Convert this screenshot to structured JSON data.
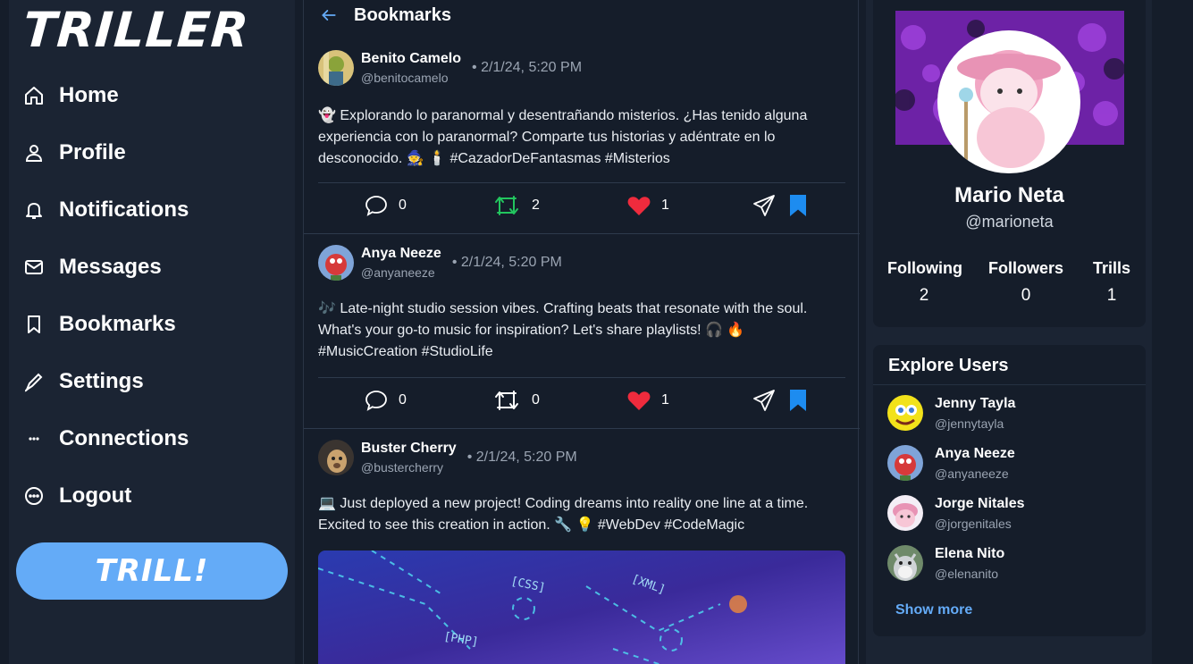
{
  "app": {
    "logo": "TRILLER",
    "trill_button": "TRILL!"
  },
  "sidebar": {
    "items": [
      {
        "label": "Home",
        "icon": "home-icon"
      },
      {
        "label": "Profile",
        "icon": "user-icon"
      },
      {
        "label": "Notifications",
        "icon": "bell-icon"
      },
      {
        "label": "Messages",
        "icon": "mail-icon"
      },
      {
        "label": "Bookmarks",
        "icon": "bookmark-icon"
      },
      {
        "label": "Settings",
        "icon": "pen-icon"
      },
      {
        "label": "Connections",
        "icon": "dots-icon"
      },
      {
        "label": "Logout",
        "icon": "dots-circle-icon"
      }
    ]
  },
  "feed": {
    "title": "Bookmarks",
    "posts": [
      {
        "name": "Benito Camelo",
        "handle": "@benitocamelo",
        "time": "• 2/1/24, 5:20 PM",
        "text": "👻 Explorando lo paranormal y desentrañando misterios. ¿Has tenido alguna experiencia con lo paranormal? Comparte tus historias y adéntrate en lo desconocido. 🧙 🕯️ #CazadorDeFantasmas #Misterios",
        "comments": "0",
        "retrills": "2",
        "likes": "1",
        "retrilled": true
      },
      {
        "name": "Anya Neeze",
        "handle": "@anyaneeze",
        "time": "• 2/1/24, 5:20 PM",
        "text": "🎶 Late-night studio session vibes. Crafting beats that resonate with the soul. What's your go-to music for inspiration? Let's share playlists! 🎧 🔥 #MusicCreation #StudioLife",
        "comments": "0",
        "retrills": "0",
        "likes": "1",
        "retrilled": false
      },
      {
        "name": "Buster Cherry",
        "handle": "@bustercherry",
        "time": "• 2/1/24, 5:20 PM",
        "text": "💻 Just deployed a new project! Coding dreams into reality one line at a time. Excited to see this creation in action. 🔧 💡 #WebDev #CodeMagic",
        "image_labels": [
          "[CSS]",
          "[XML]",
          "[PHP]"
        ]
      }
    ]
  },
  "profile": {
    "name": "Mario Neta",
    "handle": "@marioneta",
    "stats": [
      {
        "label": "Following",
        "value": "2"
      },
      {
        "label": "Followers",
        "value": "0"
      },
      {
        "label": "Trills",
        "value": "1"
      }
    ]
  },
  "explore": {
    "title": "Explore Users",
    "users": [
      {
        "name": "Jenny Tayla",
        "handle": "@jennytayla"
      },
      {
        "name": "Anya Neeze",
        "handle": "@anyaneeze"
      },
      {
        "name": "Jorge Nitales",
        "handle": "@jorgenitales"
      },
      {
        "name": "Elena Nito",
        "handle": "@elenanito"
      }
    ],
    "show_more": "Show more"
  },
  "colors": {
    "accent": "#64abf7",
    "retrill_active": "#22c55e",
    "like": "#ef2b3d",
    "bookmark": "#1d8cf0",
    "background": "#151d2a",
    "panel": "#1b2433"
  }
}
